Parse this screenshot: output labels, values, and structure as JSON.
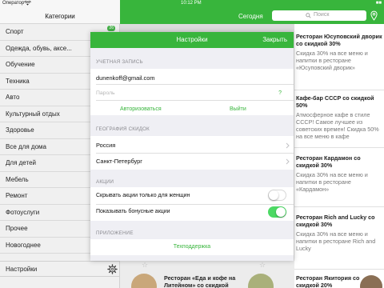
{
  "status_bar": {
    "carrier": "Оператор",
    "time": "10:12 PM",
    "battery": "■■"
  },
  "sidebar": {
    "title": "Категории",
    "badge": "26",
    "items": [
      {
        "label": "Спорт"
      },
      {
        "label": "Одежда, обувь, аксе..."
      },
      {
        "label": "Обучение"
      },
      {
        "label": "Техника"
      },
      {
        "label": "Авто"
      },
      {
        "label": "Культурный отдых"
      },
      {
        "label": "Здоровье"
      },
      {
        "label": "Все для дома"
      },
      {
        "label": "Для детей"
      },
      {
        "label": "Мебель"
      },
      {
        "label": "Ремонт"
      },
      {
        "label": "Фотоуслуги"
      },
      {
        "label": "Прочее"
      },
      {
        "label": "Новогоднее"
      }
    ],
    "settings_label": "Настройки"
  },
  "topbar": {
    "today_label": "Сегодня",
    "search_placeholder": "Поиск"
  },
  "deals": [
    {
      "title": "Ресторан Юсуповский дворик со скидкой 30%",
      "desc": "Скидка 30% на все меню и напитки в ресторане «Юсуповский дворик»"
    },
    {
      "title": "Кафе-бар СССР со скидкой 50%",
      "desc": "Атмосферное кафе в стиле СССР! Самое лучшее из советских времен! Скидка 50% на все меню в кафе"
    },
    {
      "title": "Ресторан Кардамон со скидкой 30%",
      "desc": "Скидка 30% на все меню и напитки в ресторане «Кардамон»"
    },
    {
      "title": "Ресторан Rich and Lucky со скидкой 30%",
      "desc": "Скидка 30% на все меню и напитки в ресторане Rich and Lucky"
    },
    {
      "title": "Ресторан Якитория со скидкой 20%",
      "desc": ""
    }
  ],
  "bottom_deal": {
    "title": "Ресторан «Еда и кофе на Литейном» со скидкой"
  },
  "modal": {
    "title": "Настройки",
    "close_label": "Закрыть",
    "account_header": "УЧЕТНАЯ ЗАПИСЬ",
    "email_value": "dunenkoff@gmail.com",
    "password_placeholder": "Пароль",
    "password_help": "?",
    "login_label": "Авторизоваться",
    "logout_label": "Выйти",
    "geo_header": "ГЕОГРАФИЯ СКИДОК",
    "country": "Россия",
    "city": "Санкт-Петербург",
    "promo_header": "АКЦИИ",
    "women_only_label": "Скрывать акции только для женщин",
    "women_only_on": false,
    "bonus_label": "Показывать бонусные акции",
    "bonus_on": true,
    "app_header": "ПРИЛОЖЕНИЕ",
    "support_label": "Техподдержка"
  },
  "colors": {
    "accent_green": "#38b53c",
    "toggle_on": "#4cd964"
  }
}
